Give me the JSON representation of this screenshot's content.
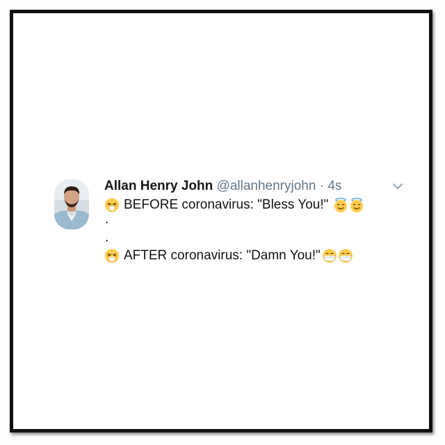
{
  "tweet": {
    "display_name": "Allan Henry John",
    "handle": "@allanhenryjohn",
    "separator": "·",
    "time": "4s",
    "line1_text": "BEFORE coronavirus: \"Bless You!\"",
    "dot1": ".",
    "dot2": ".",
    "line2_text": "AFTER coronavirus: \"Damn You!\""
  },
  "icons": {
    "sneeze": "sneezing-face-emoji",
    "halo": "smiling-face-with-halo-emoji",
    "mask": "face-with-medical-mask-emoji",
    "menu": "chevron-down-icon"
  },
  "colors": {
    "frame": "#111111",
    "secondary_text": "#657786",
    "chevron": "#8899a6"
  }
}
